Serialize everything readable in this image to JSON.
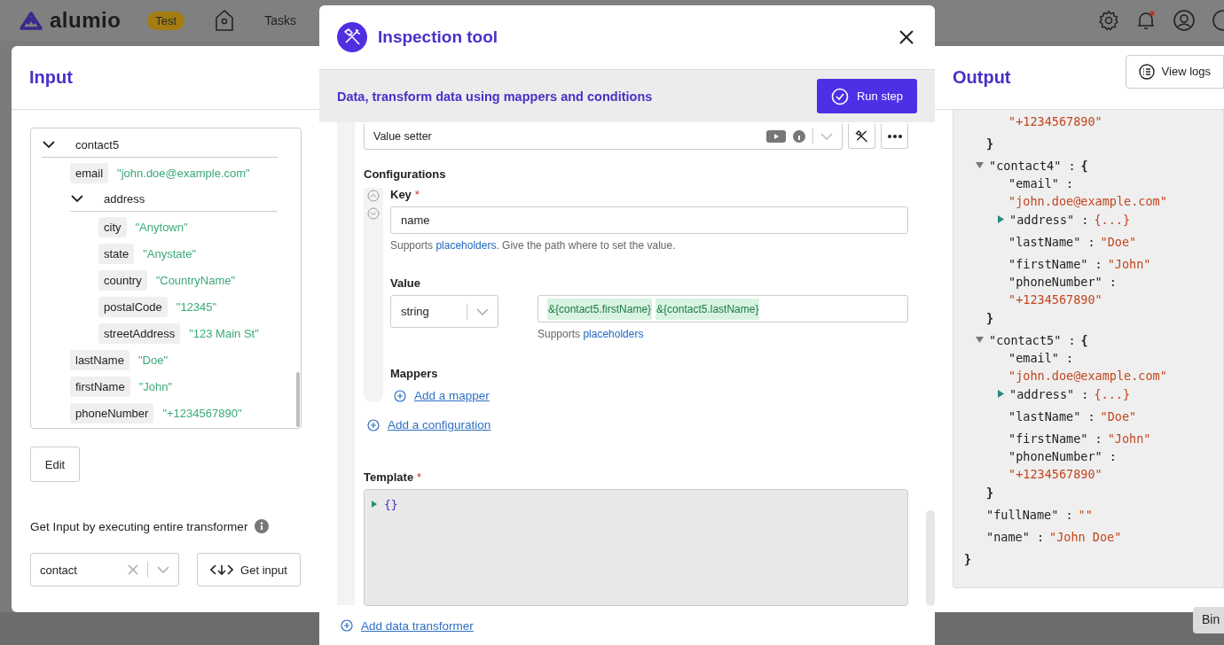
{
  "nav": {
    "brand": "alumio",
    "env_badge": "Test",
    "links": [
      "Tasks"
    ],
    "has_notification": true
  },
  "input_panel": {
    "title": "Input",
    "tree": [
      {
        "key": "contact5",
        "expanded": true,
        "children": [
          {
            "key": "email",
            "value": "\"john.doe@example.com\""
          },
          {
            "key": "address",
            "expanded": true,
            "children": [
              {
                "key": "city",
                "value": "\"Anytown\""
              },
              {
                "key": "state",
                "value": "\"Anystate\""
              },
              {
                "key": "country",
                "value": "\"CountryName\""
              },
              {
                "key": "postalCode",
                "value": "\"12345\""
              },
              {
                "key": "streetAddress",
                "value": "\"123 Main St\""
              }
            ]
          },
          {
            "key": "lastName",
            "value": "\"Doe\""
          },
          {
            "key": "firstName",
            "value": "\"John\""
          },
          {
            "key": "phoneNumber",
            "value": "\"+1234567890\""
          }
        ]
      }
    ],
    "edit_button": "Edit",
    "get_input_label": "Get Input by executing entire transformer",
    "select_value": "contact",
    "get_input_button": "Get input"
  },
  "modal": {
    "title": "Inspection tool",
    "subtitle": "Data, transform data using mappers and conditions",
    "run_button": "Run step",
    "step_select": "Value setter",
    "configurations_label": "Configurations",
    "key_label": "Key",
    "key_required_mark": "*",
    "key_value": "name",
    "key_help": {
      "prefix": "Supports",
      "link": "placeholders",
      "suffix": ". Give the path where to set the value."
    },
    "value_label": "Value",
    "type_select": "string",
    "value_tokens": [
      "&{contact5.firstName}",
      "&{contact5.lastName}"
    ],
    "value_help": {
      "prefix": "Supports",
      "link": "placeholders"
    },
    "mappers_label": "Mappers",
    "add_mapper": "Add a mapper",
    "add_configuration": "Add a configuration",
    "template_label": "Template",
    "template_required_mark": "*",
    "template_code": "{}",
    "add_transformer": "Add data transformer"
  },
  "output_panel": {
    "title": "Output",
    "logs_button": "View logs",
    "json": {
      "tail": {
        "children": [
          {
            "value": "\"+1234567890\""
          }
        ],
        "close": "}"
      },
      "nodes": [
        {
          "key": "\"contact4\" :",
          "open": "{",
          "close": "}",
          "expanded": true,
          "children": [
            {
              "key": "\"email\" :",
              "value": "\"john.doe@example.com\""
            },
            {
              "key": "\"address\" :",
              "expanded": false,
              "summary": "{...}"
            },
            {
              "key": "\"lastName\" :",
              "value": "\"Doe\""
            },
            {
              "key": "\"firstName\" :",
              "value": "\"John\""
            },
            {
              "key": "\"phoneNumber\" :",
              "value": "\"+1234567890\""
            }
          ]
        },
        {
          "key": "\"contact5\" :",
          "open": "{",
          "close": "}",
          "expanded": true,
          "children": [
            {
              "key": "\"email\" :",
              "value": "\"john.doe@example.com\""
            },
            {
              "key": "\"address\" :",
              "expanded": false,
              "summary": "{...}"
            },
            {
              "key": "\"lastName\" :",
              "value": "\"Doe\""
            },
            {
              "key": "\"firstName\" :",
              "value": "\"John\""
            },
            {
              "key": "\"phoneNumber\" :",
              "value": "\"+1234567890\""
            }
          ]
        },
        {
          "key": "\"fullName\" :",
          "value": "\"\""
        },
        {
          "key": "\"name\" :",
          "value": "\"John Doe\""
        }
      ],
      "close": "}"
    }
  },
  "tooltip": "Bin"
}
